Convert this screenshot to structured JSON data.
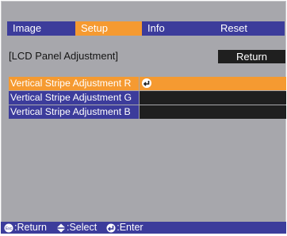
{
  "tabs": [
    {
      "label": "Image",
      "active": false
    },
    {
      "label": "Setup",
      "active": true
    },
    {
      "label": "Info",
      "active": false
    },
    {
      "label": "Reset",
      "active": false
    }
  ],
  "section": {
    "title": "[LCD Panel Adjustment]",
    "return_label": "Return"
  },
  "items": [
    {
      "label": "Vertical Stripe Adjustment R",
      "active": true
    },
    {
      "label": "Vertical Stripe Adjustment G",
      "active": false
    },
    {
      "label": "Vertical Stripe Adjustment B",
      "active": false
    }
  ],
  "footer": {
    "return_label": ":Return",
    "select_label": ":Select",
    "enter_label": ":Enter",
    "icons": [
      "esc-icon",
      "updown-arrow-icon",
      "enter-icon"
    ]
  },
  "colors": {
    "accent": "#f59a31",
    "bar": "#3c3c9b",
    "panel": "#a7a7ac",
    "dark": "#1f1f1f"
  }
}
